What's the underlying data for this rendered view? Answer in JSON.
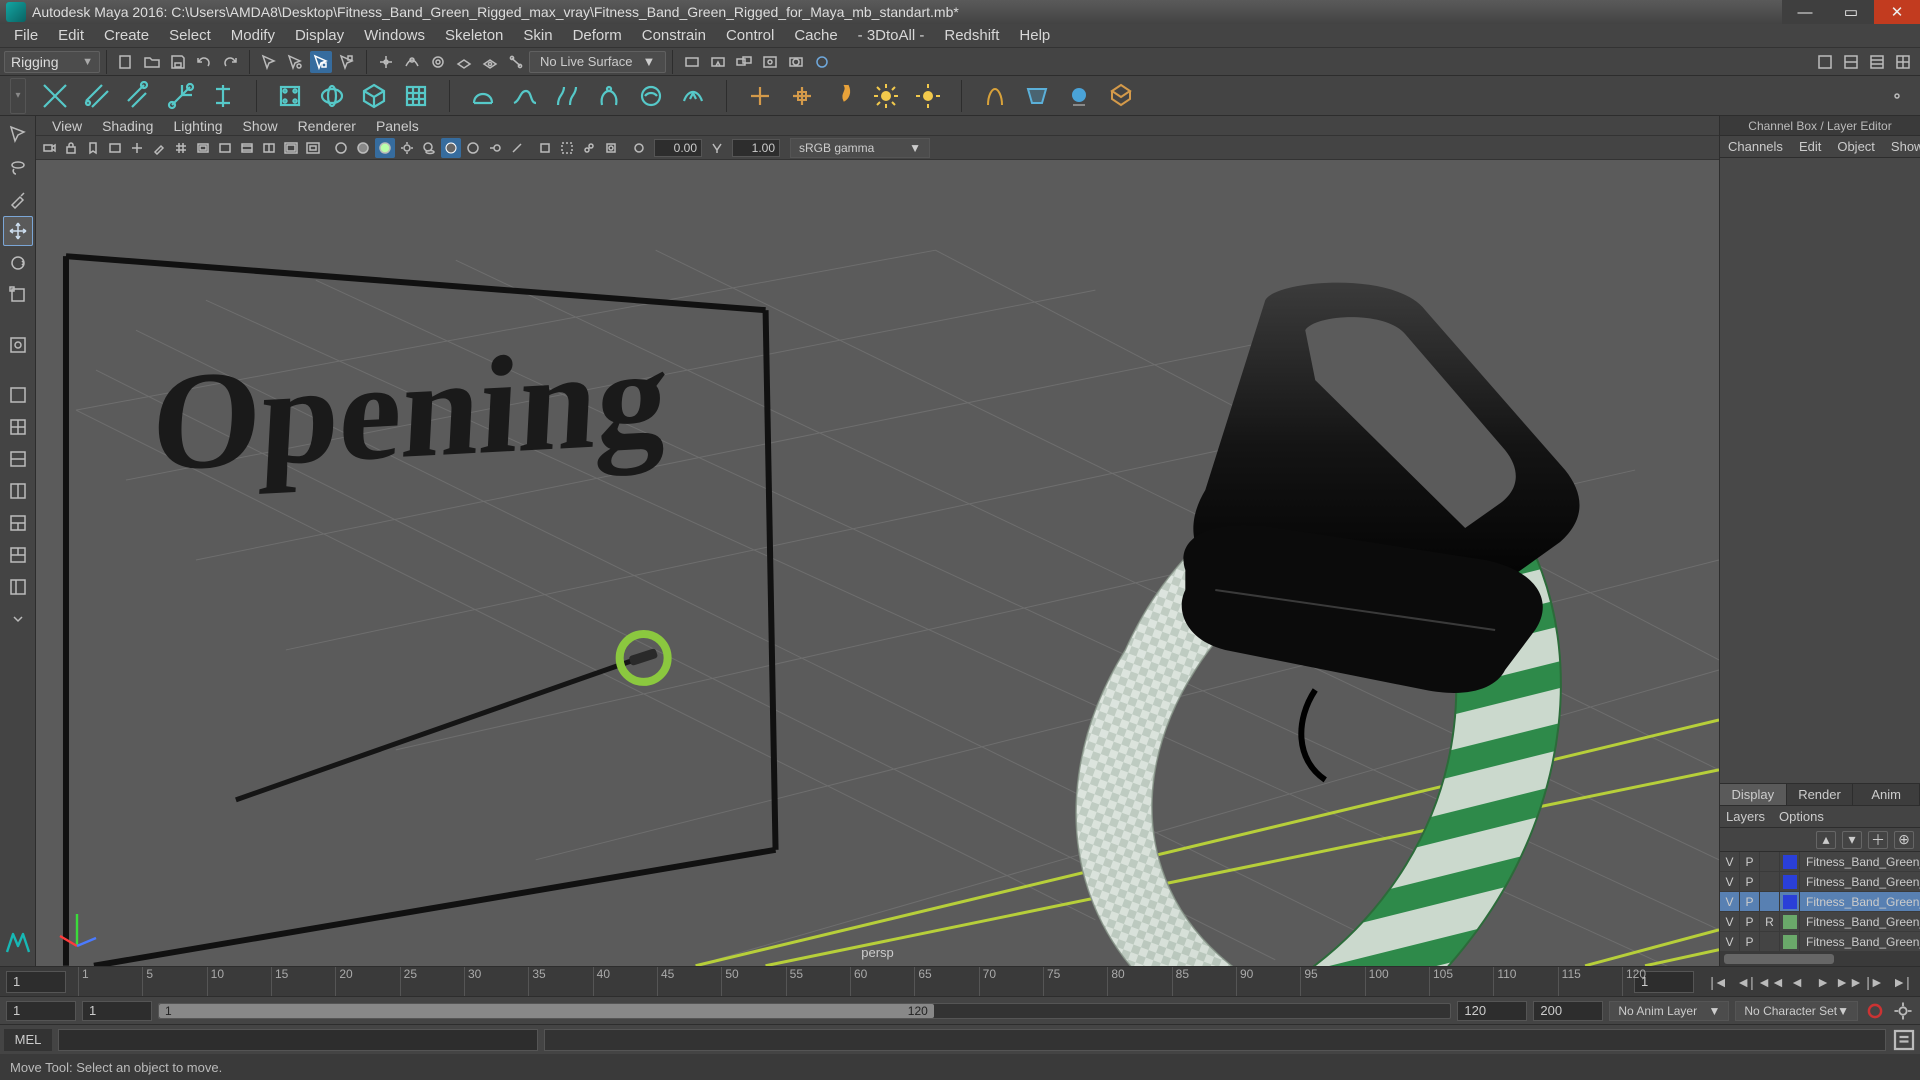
{
  "titlebar": {
    "text": "Autodesk Maya 2016: C:\\Users\\AMDA8\\Desktop\\Fitness_Band_Green_Rigged_max_vray\\Fitness_Band_Green_Rigged_for_Maya_mb_standart.mb*"
  },
  "menu": [
    "File",
    "Edit",
    "Create",
    "Select",
    "Modify",
    "Display",
    "Windows",
    "Skeleton",
    "Skin",
    "Deform",
    "Constrain",
    "Control",
    "Cache",
    "- 3DtoAll -",
    "Redshift",
    "Help"
  ],
  "module_dropdown": "Rigging",
  "live_surface": "No Live Surface",
  "panel_menu": [
    "View",
    "Shading",
    "Lighting",
    "Show",
    "Renderer",
    "Panels"
  ],
  "viewport": {
    "exposure": "0.00",
    "gamma": "1.00",
    "color_mgmt": "sRGB gamma",
    "camera": "persp",
    "annotation_text": "Opening"
  },
  "right_panel": {
    "title": "Channel Box / Layer Editor",
    "top_tabs": [
      "Channels",
      "Edit",
      "Object",
      "Show"
    ],
    "bottom_tabs": [
      "Display",
      "Render",
      "Anim"
    ],
    "bottom_opts": [
      "Layers",
      "Options"
    ],
    "layers": [
      {
        "v": "V",
        "p": "P",
        "r": "",
        "sw": "#2a3fd8",
        "name": "Fitness_Band_Green_R",
        "sel": false
      },
      {
        "v": "V",
        "p": "P",
        "r": "",
        "sw": "#2a3fd8",
        "name": "Fitness_Band_Green_R",
        "sel": false
      },
      {
        "v": "V",
        "p": "P",
        "r": "",
        "sw": "#2a3fd8",
        "name": "Fitness_Band_Green_R",
        "sel": true
      },
      {
        "v": "V",
        "p": "P",
        "r": "R",
        "sw": "#6aa86a",
        "name": "Fitness_Band_Green_R",
        "sel": false
      },
      {
        "v": "V",
        "p": "P",
        "r": "",
        "sw": "#6aa86a",
        "name": "Fitness_Band_Green_R",
        "sel": false
      }
    ]
  },
  "timeline": {
    "cur_left": "1",
    "cur_right": "1",
    "ticks": [
      "1",
      "5",
      "10",
      "15",
      "20",
      "25",
      "30",
      "35",
      "40",
      "45",
      "50",
      "55",
      "60",
      "65",
      "70",
      "75",
      "80",
      "85",
      "90",
      "95",
      "100",
      "105",
      "110",
      "115",
      "120"
    ]
  },
  "range": {
    "start_outer": "1",
    "start_inner": "1",
    "handle_label": "1",
    "end_inner": "120",
    "end_outer": "120",
    "end_outer2": "200",
    "anim_layer": "No Anim Layer",
    "char_set": "No Character Set"
  },
  "cmd": {
    "lang": "MEL"
  },
  "help": "Move Tool: Select an object to move."
}
